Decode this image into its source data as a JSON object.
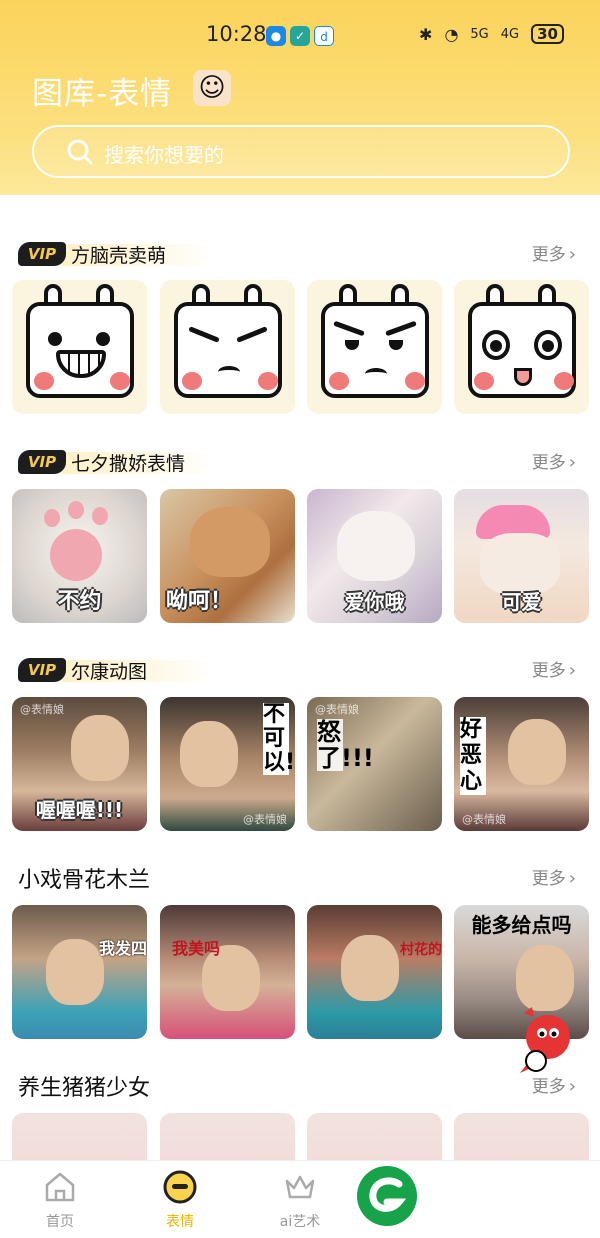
{
  "status_bar": {
    "time": "10:28",
    "network1": "5G",
    "network2": "4G",
    "battery": "30"
  },
  "header": {
    "title": "图库-表情",
    "search_placeholder": "搜索你想要的"
  },
  "more_label": "更多",
  "sections": [
    {
      "title": "方脑壳卖萌",
      "vip": "VIP",
      "items": [
        {
          "caption": ""
        },
        {
          "caption": ""
        },
        {
          "caption": ""
        },
        {
          "caption": ""
        }
      ]
    },
    {
      "title": "七夕撒娇表情",
      "vip": "VIP",
      "items": [
        {
          "caption": "不约"
        },
        {
          "caption": "呦呵！"
        },
        {
          "caption": "爱你哦"
        },
        {
          "caption": "可爱"
        }
      ]
    },
    {
      "title": "尔康动图",
      "vip": "VIP",
      "items": [
        {
          "caption": "喔喔喔!!!"
        },
        {
          "caption": "不可以!!!"
        },
        {
          "caption": "怒了!!!"
        },
        {
          "caption": "好恶心"
        }
      ]
    },
    {
      "title": "小戏骨花木兰",
      "items": [
        {
          "caption": "我发四"
        },
        {
          "caption": "我美吗"
        },
        {
          "caption": "村花的"
        },
        {
          "caption": "能多给点吗"
        }
      ]
    },
    {
      "title": "养生猪猪少女",
      "items": []
    }
  ],
  "watermark": "@表情娘",
  "tabs": [
    {
      "label": "首页",
      "icon": "home-icon",
      "active": false
    },
    {
      "label": "表情",
      "icon": "emoji-icon",
      "active": true
    },
    {
      "label": "ai艺术",
      "icon": "crown-icon",
      "active": false
    }
  ],
  "colors": {
    "header_yellow": "#fbd35a",
    "active_tab": "#e8b400",
    "vip_gold": "#f6c84a",
    "fab_green": "#16a34a"
  }
}
